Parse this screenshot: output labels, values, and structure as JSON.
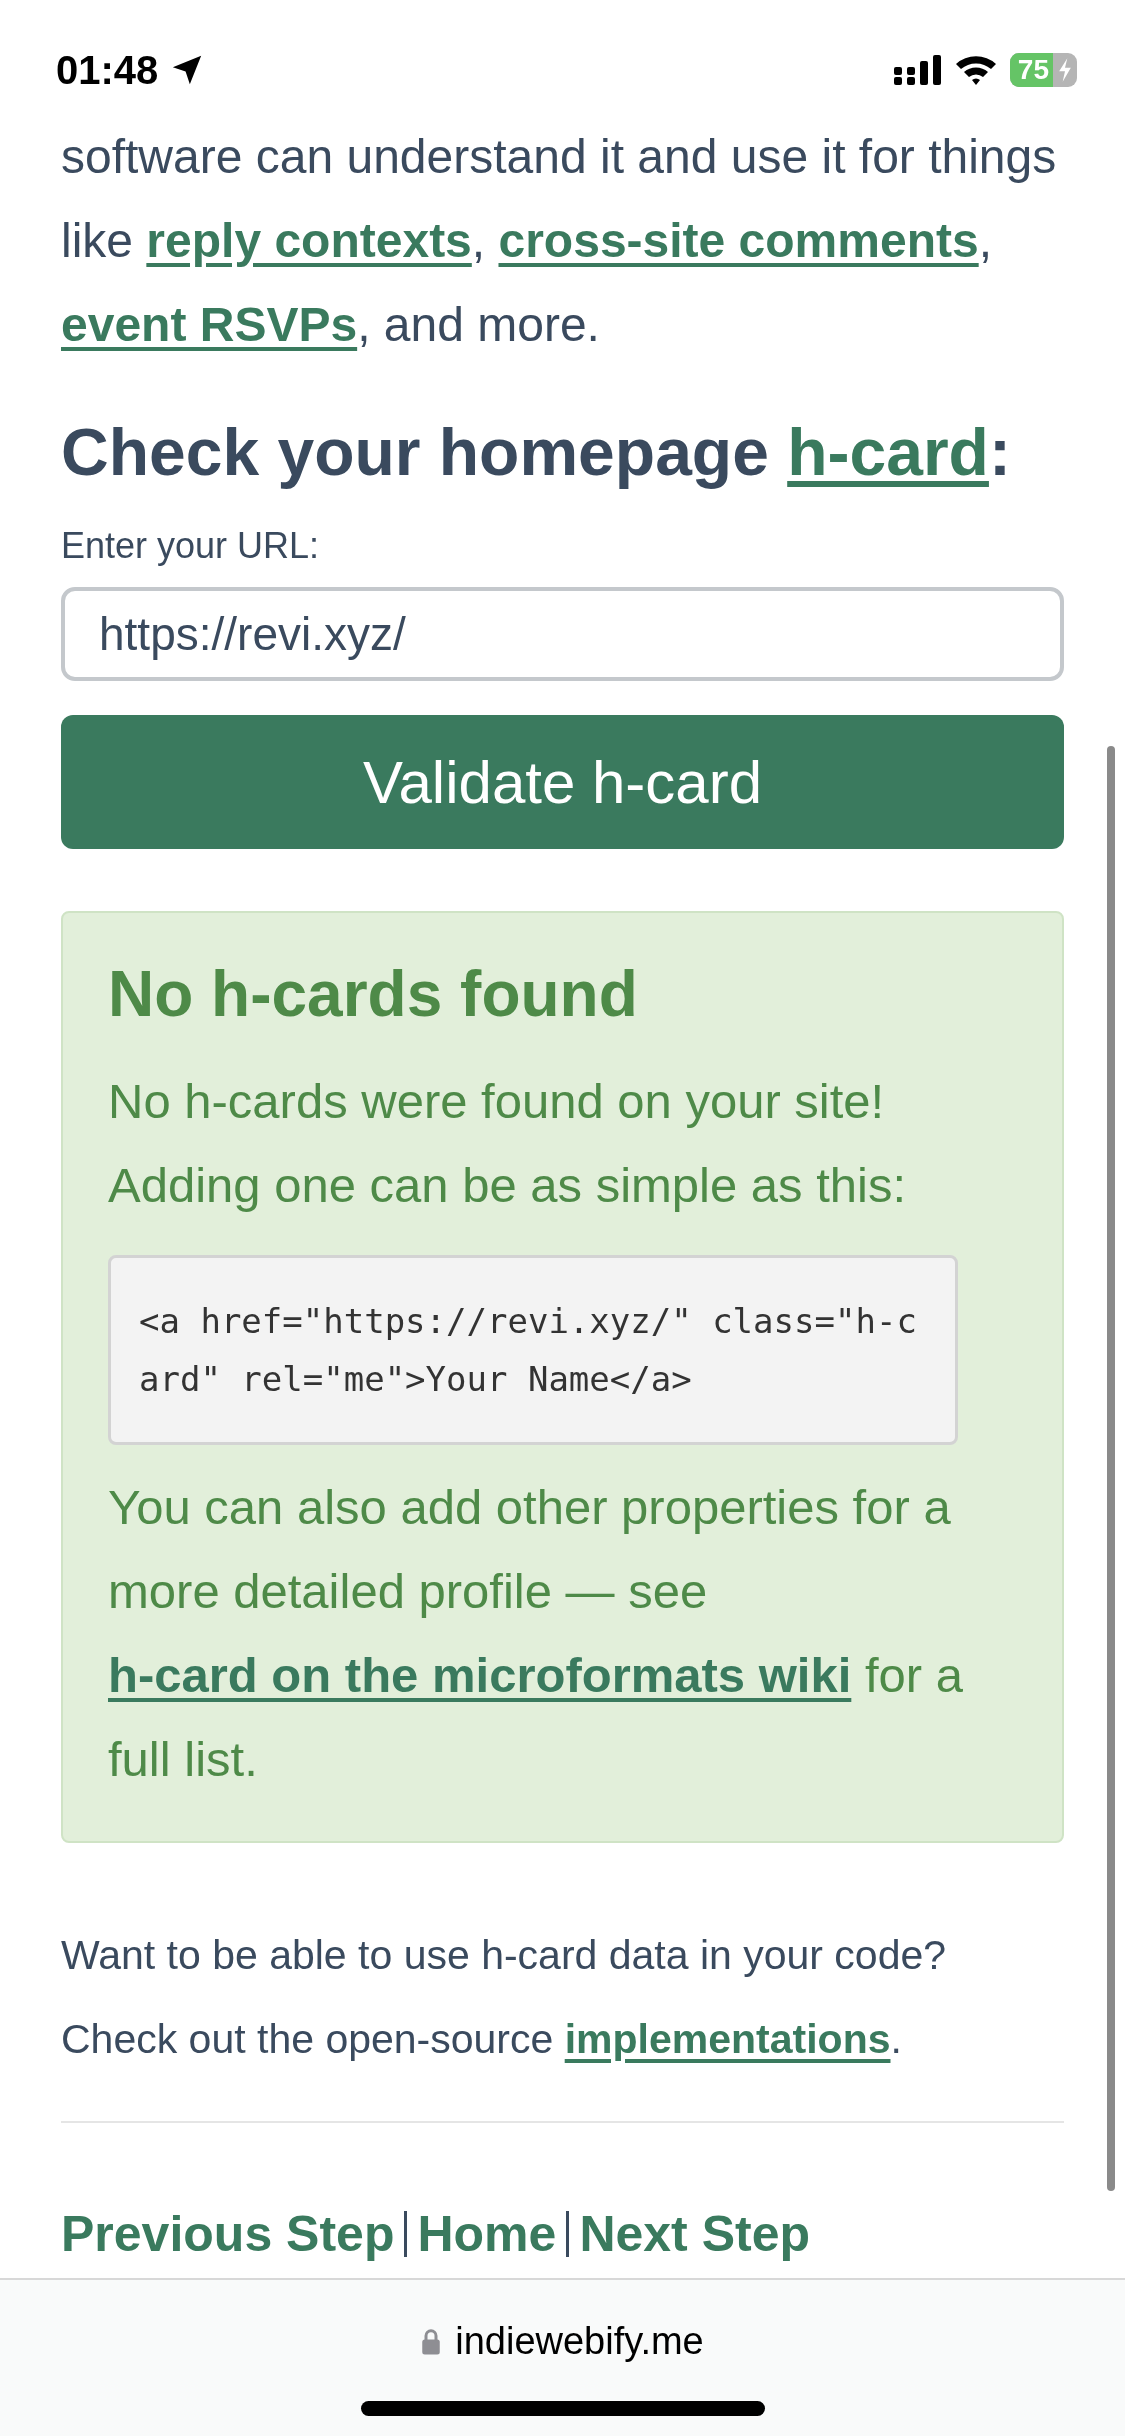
{
  "status_bar": {
    "time": "01:48",
    "battery": "75"
  },
  "intro": [
    {
      "kind": "text",
      "text": "software can understand it and use it for things like "
    },
    {
      "kind": "link",
      "text": "reply contexts"
    },
    {
      "kind": "text",
      "text": ", "
    },
    {
      "kind": "link",
      "text": "cross-site comments"
    },
    {
      "kind": "text",
      "text": ", "
    },
    {
      "kind": "link",
      "text": "event RSVPs"
    },
    {
      "kind": "text",
      "text": ", and more."
    }
  ],
  "heading": [
    {
      "kind": "text",
      "text": "Check your homepage "
    },
    {
      "kind": "link",
      "text": "h-card"
    },
    {
      "kind": "text",
      "text": ":"
    }
  ],
  "url_field": {
    "label": "Enter your URL:",
    "value": "https://revi.xyz/"
  },
  "validate_button": "Validate h-card",
  "result": {
    "title": "No h-cards found",
    "message": "No h-cards were found on your site! Adding one can be as simple as this:",
    "code": "<a href=\"https://revi.xyz/\" class=\"h-card\" rel=\"me\">Your Name</a>",
    "details": [
      {
        "kind": "text",
        "text": "You can also add other properties for a more detailed profile — see "
      },
      {
        "kind": "link",
        "text": "h-card on the microformats wiki"
      },
      {
        "kind": "text",
        "text": " for a full list."
      }
    ]
  },
  "code_note": [
    {
      "kind": "text",
      "text": "Want to be able to use h-card data in your code? Check out the open-source "
    },
    {
      "kind": "link",
      "text": "implementations"
    },
    {
      "kind": "text",
      "text": "."
    }
  ],
  "nav": [
    "Previous Step",
    "Home",
    "Next Step"
  ],
  "address_bar": {
    "domain": "indiewebify.me"
  }
}
